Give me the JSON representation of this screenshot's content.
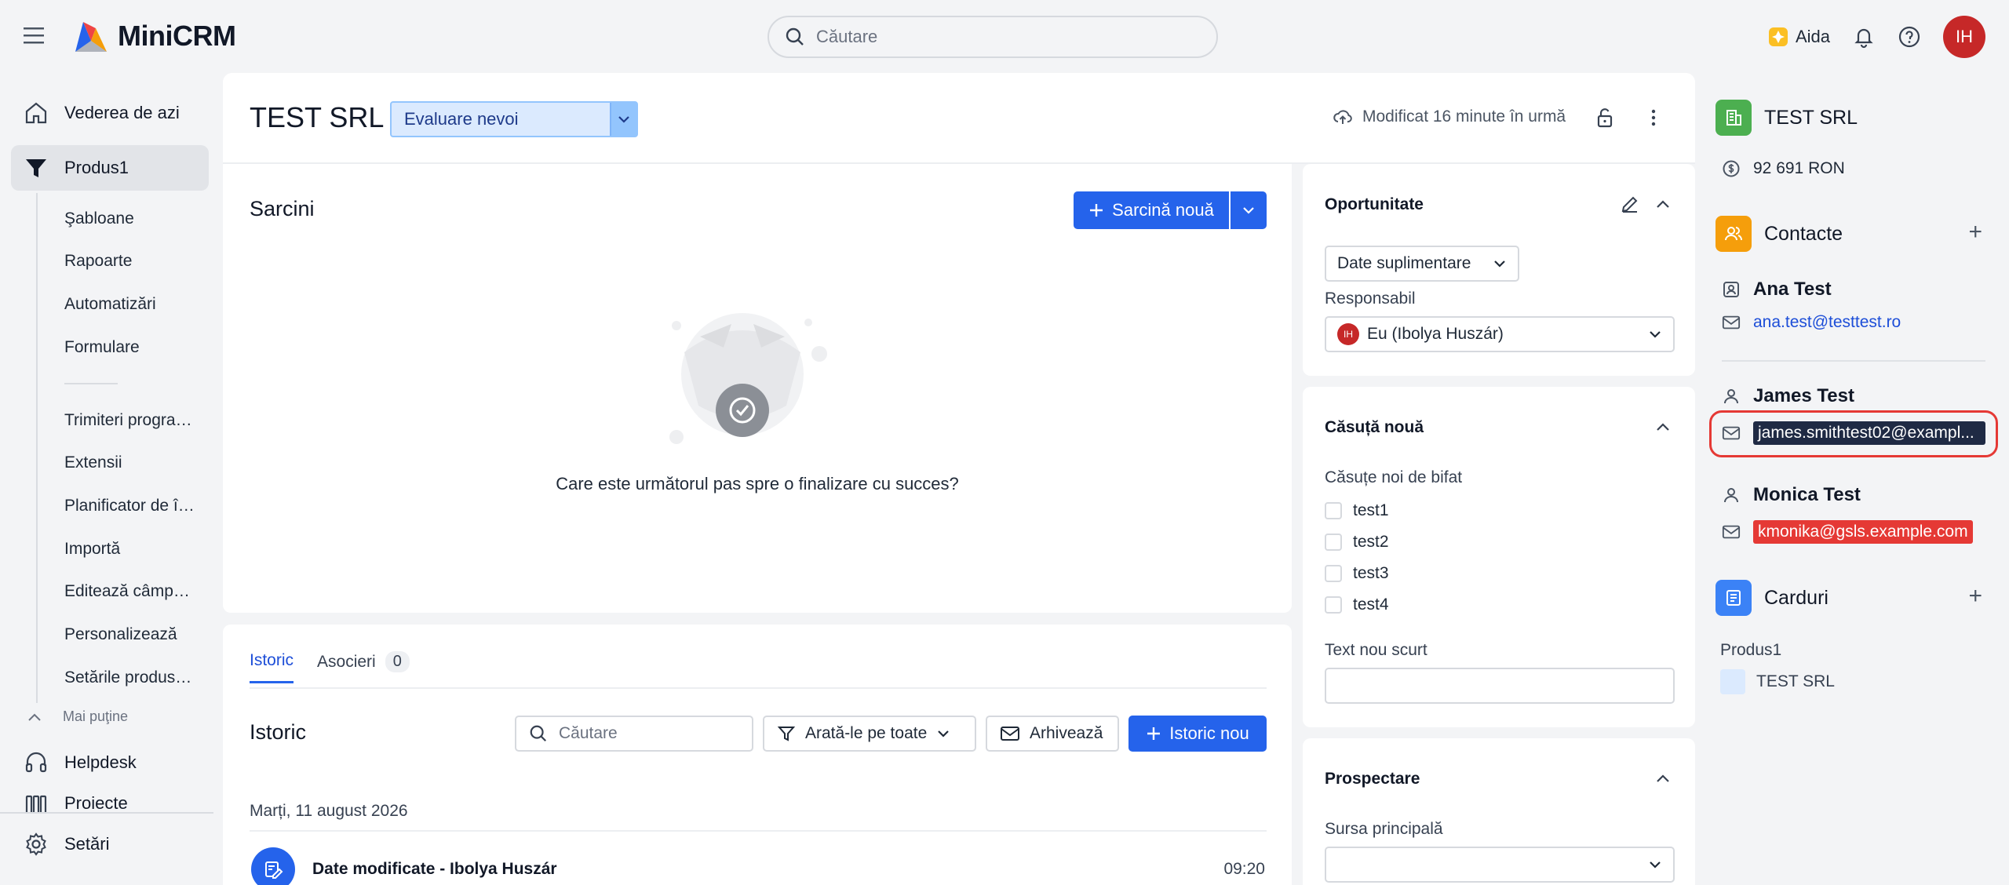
{
  "app": {
    "name": "MiniCRM"
  },
  "topbar": {
    "search_placeholder": "Căutare",
    "aida_label": "Aida",
    "user_initials": "IH"
  },
  "sidebar": {
    "today": "Vederea de azi",
    "product": "Produs1",
    "sub_items": [
      "Şabloane",
      "Rapoarte",
      "Automatizări",
      "Formulare",
      "Trimiteri programate",
      "Extensii",
      "Planificator de întâlniri",
      "Importă",
      "Editează câmpurile",
      "Personalizează",
      "Setările produsului"
    ],
    "less": "Mai puţine",
    "helpdesk": "Helpdesk",
    "projects": "Proiecte",
    "settings": "Setări"
  },
  "header": {
    "title": "TEST SRL",
    "stage": "Evaluare nevoi",
    "modified": "Modificat 16 minute în urmă"
  },
  "tasks": {
    "title": "Sarcini",
    "new_task": "Sarcină nouă",
    "empty_text": "Care este următorul pas spre o finalizare cu succes?"
  },
  "history": {
    "tab_history": "Istoric",
    "tab_assoc": "Asocieri",
    "assoc_count": "0",
    "title": "Istoric",
    "search_placeholder": "Căutare",
    "filter_label": "Arată-le pe toate",
    "archive_label": "Arhivează",
    "new_label": "Istoric nou",
    "date": "Marți, 11 august 2026",
    "entry_title": "Date modificate - Ibolya Huszár",
    "entry_time": "09:20"
  },
  "opportunity": {
    "title": "Oportunitate",
    "extra_data": "Date suplimentare",
    "responsible_label": "Responsabil",
    "responsible_value": "Eu (Ibolya Huszár)",
    "responsible_initials": "IH"
  },
  "new_box": {
    "title": "Căsuță nouă",
    "checks_label": "Căsuțe noi de bifat",
    "checks": [
      "test1",
      "test2",
      "test3",
      "test4"
    ],
    "short_text_label": "Text nou scurt"
  },
  "prospecting": {
    "title": "Prospectare",
    "main_source_label": "Sursa principală"
  },
  "right": {
    "company": "TEST SRL",
    "amount": "92 691 RON",
    "contacts_title": "Contacte",
    "contacts": [
      {
        "name": "Ana Test",
        "email": "ana.test@testtest.ro"
      },
      {
        "name": "James Test",
        "email": "james.smithtest02@exampl..."
      },
      {
        "name": "Monica Test",
        "email": "kmonika@gsls.example.com"
      }
    ],
    "cards_title": "Carduri",
    "cards_product": "Produs1",
    "cards_item": "TEST SRL"
  },
  "colors": {
    "primary": "#2563eb",
    "avatar": "#c62828",
    "highlight": "#e53935"
  }
}
